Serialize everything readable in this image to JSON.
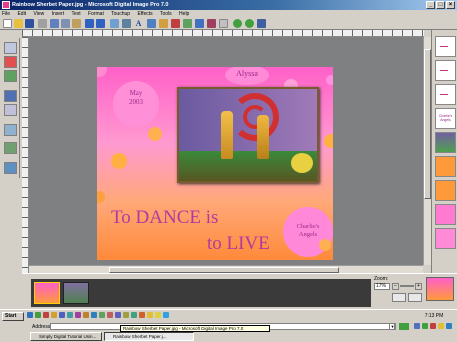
{
  "window": {
    "title": "Rainbow Sherbet Paper.jpg - Microsoft Digital Image Pro 7.0"
  },
  "menu": {
    "items": [
      "File",
      "Edit",
      "View",
      "Insert",
      "Text",
      "Format",
      "Touchup",
      "Effects",
      "Tools",
      "Help"
    ]
  },
  "document": {
    "header_text": "Alyssa",
    "date_line1": "May",
    "date_line2": "2003",
    "headline_line1": "To DANCE is",
    "headline_line2": "to LIVE",
    "badge_line1": "Charlie's",
    "badge_line2": "Angels",
    "colors": {
      "text": "#9a2a8a",
      "pink": "#ff60c8",
      "orange": "#ff8a3a"
    }
  },
  "right_panel": {
    "badge_line1": "Charlie's",
    "badge_line2": "Angels"
  },
  "zoom": {
    "label": "Zoom:",
    "value": "17%"
  },
  "taskbar": {
    "start_label": "Start",
    "address_label": "Address",
    "clock_time": "7:13 PM",
    "tasks": [
      "Simply Digital Tutorial Usin...",
      "Rainbow Sherbet Paper.j..."
    ],
    "tooltip": "Rainbow Sherbet Paper.jpg - Microsoft Digital Image Pro 7.0"
  }
}
